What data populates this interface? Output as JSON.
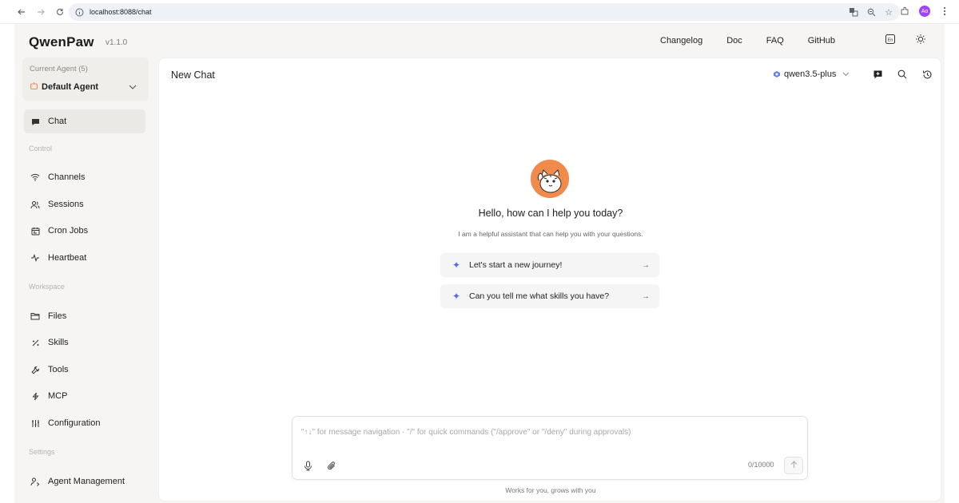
{
  "browser": {
    "url": "localhost:8088/chat",
    "profile_initials": "Ao"
  },
  "header": {
    "logo": "QwenPaw",
    "version": "v1.1.0",
    "nav": [
      "Changelog",
      "Doc",
      "FAQ",
      "GitHub"
    ]
  },
  "sidebar": {
    "agent_label": "Current Agent (5)",
    "agent_name": "Default Agent",
    "chat_label": "Chat",
    "sections": {
      "control": "Control",
      "workspace": "Workspace",
      "settings": "Settings"
    },
    "control_items": [
      "Channels",
      "Sessions",
      "Cron Jobs",
      "Heartbeat"
    ],
    "workspace_items": [
      "Files",
      "Skills",
      "Tools",
      "MCP",
      "Configuration"
    ],
    "settings_items": [
      "Agent Management"
    ]
  },
  "main": {
    "title": "New Chat",
    "model": "qwen3.5-plus",
    "welcome_title": "Hello, how can I help you today?",
    "welcome_sub": "I am a helpful assistant that can help you with your questions.",
    "prompts": [
      "Let's start a new journey!",
      "Can you tell me what skills you have?"
    ],
    "composer_placeholder": "\"↑↓\" for message navigation · \"/\" for quick commands (\"/approve\" or \"/deny\" during approvals)",
    "char_count": "0/10000",
    "footer_note": "Works for you, grows with you"
  },
  "colors": {
    "accent": "#4b6cf7",
    "avatar_bg": "#f28a4b",
    "active_item_bg": "#ebe9e5",
    "app_bg": "#f6f5f3"
  }
}
